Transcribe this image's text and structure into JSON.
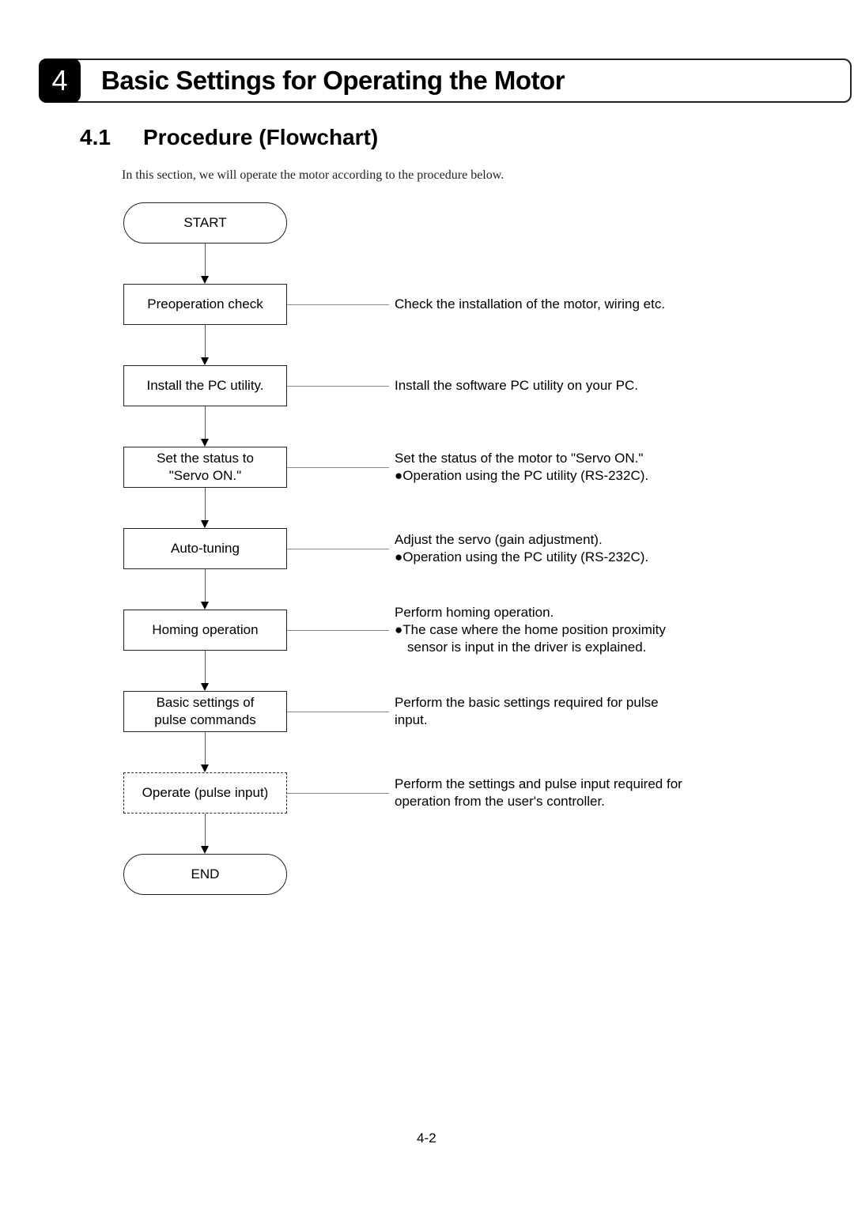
{
  "chapter": {
    "number": "4",
    "title": "Basic Settings for Operating the Motor"
  },
  "section": {
    "number": "4.1",
    "title": "Procedure (Flowchart)"
  },
  "intro": "In this section, we will operate the motor according to the procedure below.",
  "flowchart": {
    "start": "START",
    "end": "END",
    "steps": [
      {
        "label_lines": [
          "Preoperation check"
        ],
        "description": [
          "Check the installation of the motor, wiring etc."
        ]
      },
      {
        "label_lines": [
          "Install the PC utility."
        ],
        "description": [
          "Install the software PC utility on your PC."
        ]
      },
      {
        "label_lines": [
          "Set the status to",
          "\"Servo ON.\""
        ],
        "description": [
          "Set the status of the motor to \"Servo ON.\"",
          "●Operation using the PC utility (RS-232C)."
        ]
      },
      {
        "label_lines": [
          "Auto-tuning"
        ],
        "description": [
          "Adjust the servo (gain adjustment).",
          "●Operation using the PC utility (RS-232C)."
        ]
      },
      {
        "label_lines": [
          "Homing operation"
        ],
        "description": [
          "Perform homing operation.",
          "●The case where the home position proximity",
          "sensor is input in the driver is explained."
        ]
      },
      {
        "label_lines": [
          "Basic settings of",
          "pulse commands"
        ],
        "description": [
          "Perform the basic settings required for pulse",
          "input."
        ]
      },
      {
        "label_lines": [
          "Operate (pulse input)"
        ],
        "description": [
          "Perform the settings and pulse input required for",
          "operation from the user's controller."
        ],
        "style": "dashed"
      }
    ]
  },
  "page_number": "4-2"
}
